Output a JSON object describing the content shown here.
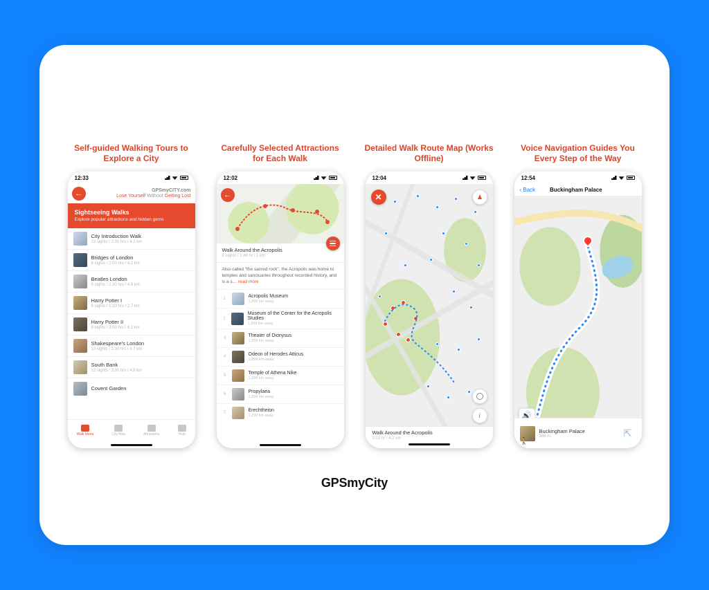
{
  "app_name": "GPSmyCity",
  "captions": [
    "Self-guided Walking Tours to Explore a City",
    "Carefully Selected Attractions for Each Walk",
    "Detailed Walk Route Map (Works Offline)",
    "Voice Navigation Guides You Every Step of the Way"
  ],
  "phone1": {
    "time": "12:33",
    "brand_url": "GPSmyCITY.com",
    "brand_tag_1": "Lose Yourself",
    "brand_tag_2": " Without ",
    "brand_tag_3": "Getting Lost",
    "banner_title": "Sightseeing Walks",
    "banner_sub": "Explore popular attractions and hidden gems",
    "walks": [
      {
        "name": "City Introduction Walk",
        "meta": "13 sights / 2:30 hrs / 4.2 km"
      },
      {
        "name": "Bridges of London",
        "meta": "8 sights / 2:00 hrs / 4.2 km"
      },
      {
        "name": "Beatles London",
        "meta": "9 sights / 2:30 hrs / 4.9 km"
      },
      {
        "name": "Harry Potter I",
        "meta": "6 sights / 1:30 hrs / 2.7 km"
      },
      {
        "name": "Harry Potter II",
        "meta": "8 sights / 3:00 hrs / 6.1 km"
      },
      {
        "name": "Shakespeare's London",
        "meta": "13 sights / 2:30 hrs / 4.7 km"
      },
      {
        "name": "South Bank",
        "meta": "12 sights / 2:30 hrs / 4.8 km"
      },
      {
        "name": "Covent Garden",
        "meta": ""
      }
    ],
    "tabs": [
      "Walk Menu",
      "City Map",
      "Attractions",
      "Help"
    ]
  },
  "phone2": {
    "time": "12:02",
    "walk_name": "Walk Around the Acropolis",
    "walk_meta": "8 sights / 2:48 hr / 1 km",
    "desc": "Also called \"the sacred rock\", the Acropolis was home to temples and sanctuaries throughout recorded history, and is a s… ",
    "read_more": "read more",
    "attractions": [
      {
        "name": "Acropolis Museum",
        "meta": "1,299 km away"
      },
      {
        "name": "Museum of the Center for the Acropolis Studies",
        "meta": "1,299 km away"
      },
      {
        "name": "Theater of Dionysus",
        "meta": "1,299 km away"
      },
      {
        "name": "Odeon of Herodes Atticus",
        "meta": "1,299 km away"
      },
      {
        "name": "Temple of Athena Nike",
        "meta": "1,299 km away"
      },
      {
        "name": "Propylaea",
        "meta": "1,299 km away"
      },
      {
        "name": "Erechtheion",
        "meta": "1,299 km away"
      }
    ]
  },
  "phone3": {
    "time": "12:04",
    "bottom_title": "Walk Around the Acropolis",
    "bottom_meta": "3:02 hr / 4.2 km"
  },
  "phone4": {
    "time": "12:54",
    "back": "Back",
    "title": "Buckingham Palace",
    "bottom_title": "Buckingham Palace",
    "bottom_meta": "386 m"
  }
}
